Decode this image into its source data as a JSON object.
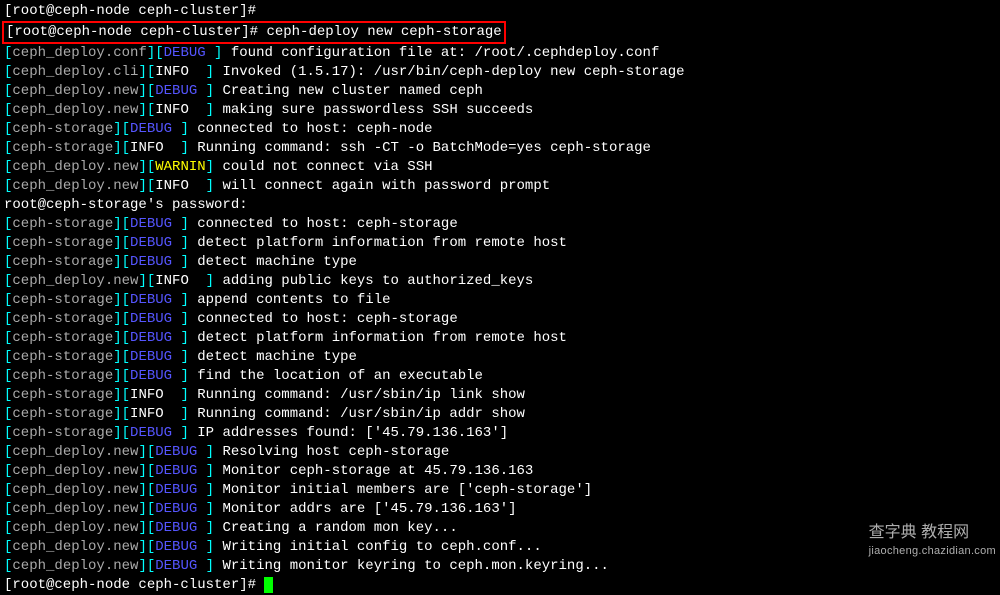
{
  "prompt": {
    "user": "root",
    "host": "ceph-node",
    "path": "ceph-cluster",
    "command": "ceph-deploy new ceph-storage"
  },
  "lines": [
    {
      "bracket_parts": [
        {
          "text": "[",
          "class": "cyan"
        },
        {
          "text": "ceph_deploy.conf",
          "class": "grey"
        },
        {
          "text": "]",
          "class": "cyan"
        },
        {
          "text": "[",
          "class": "cyan"
        },
        {
          "text": "DEBUG",
          "class": "blue"
        },
        {
          "text": " ]",
          "class": "cyan"
        }
      ],
      "msg": " found configuration file at: /root/.cephdeploy.conf"
    },
    {
      "bracket_parts": [
        {
          "text": "[",
          "class": "cyan"
        },
        {
          "text": "ceph_deploy.cli",
          "class": "grey"
        },
        {
          "text": "]",
          "class": "cyan"
        },
        {
          "text": "[",
          "class": "cyan"
        },
        {
          "text": "INFO  ",
          "class": "white"
        },
        {
          "text": "]",
          "class": "cyan"
        }
      ],
      "msg": " Invoked (1.5.17): /usr/bin/ceph-deploy new ceph-storage"
    },
    {
      "bracket_parts": [
        {
          "text": "[",
          "class": "cyan"
        },
        {
          "text": "ceph_deploy.new",
          "class": "grey"
        },
        {
          "text": "]",
          "class": "cyan"
        },
        {
          "text": "[",
          "class": "cyan"
        },
        {
          "text": "DEBUG",
          "class": "blue"
        },
        {
          "text": " ]",
          "class": "cyan"
        }
      ],
      "msg": " Creating new cluster named ceph"
    },
    {
      "bracket_parts": [
        {
          "text": "[",
          "class": "cyan"
        },
        {
          "text": "ceph_deploy.new",
          "class": "grey"
        },
        {
          "text": "]",
          "class": "cyan"
        },
        {
          "text": "[",
          "class": "cyan"
        },
        {
          "text": "INFO  ",
          "class": "white"
        },
        {
          "text": "]",
          "class": "cyan"
        }
      ],
      "msg": " making sure passwordless SSH succeeds"
    },
    {
      "bracket_parts": [
        {
          "text": "[",
          "class": "cyan"
        },
        {
          "text": "ceph-storage",
          "class": "grey"
        },
        {
          "text": "]",
          "class": "cyan"
        },
        {
          "text": "[",
          "class": "cyan"
        },
        {
          "text": "DEBUG",
          "class": "blue"
        },
        {
          "text": " ]",
          "class": "cyan"
        }
      ],
      "msg": " connected to host: ceph-node "
    },
    {
      "bracket_parts": [
        {
          "text": "[",
          "class": "cyan"
        },
        {
          "text": "ceph-storage",
          "class": "grey"
        },
        {
          "text": "]",
          "class": "cyan"
        },
        {
          "text": "[",
          "class": "cyan"
        },
        {
          "text": "INFO  ",
          "class": "white"
        },
        {
          "text": "]",
          "class": "cyan"
        }
      ],
      "msg": " Running command: ssh -CT -o BatchMode=yes ceph-storage"
    },
    {
      "bracket_parts": [
        {
          "text": "[",
          "class": "cyan"
        },
        {
          "text": "ceph_deploy.new",
          "class": "grey"
        },
        {
          "text": "]",
          "class": "cyan"
        },
        {
          "text": "[",
          "class": "cyan"
        },
        {
          "text": "WARNIN",
          "class": "yellow"
        },
        {
          "text": "]",
          "class": "cyan"
        }
      ],
      "msg": " could not connect via SSH"
    },
    {
      "bracket_parts": [
        {
          "text": "[",
          "class": "cyan"
        },
        {
          "text": "ceph_deploy.new",
          "class": "grey"
        },
        {
          "text": "]",
          "class": "cyan"
        },
        {
          "text": "[",
          "class": "cyan"
        },
        {
          "text": "INFO  ",
          "class": "white"
        },
        {
          "text": "]",
          "class": "cyan"
        }
      ],
      "msg": " will connect again with password prompt"
    },
    {
      "plain": "root@ceph-storage's password: "
    },
    {
      "bracket_parts": [
        {
          "text": "[",
          "class": "cyan"
        },
        {
          "text": "ceph-storage",
          "class": "grey"
        },
        {
          "text": "]",
          "class": "cyan"
        },
        {
          "text": "[",
          "class": "cyan"
        },
        {
          "text": "DEBUG",
          "class": "blue"
        },
        {
          "text": " ]",
          "class": "cyan"
        }
      ],
      "msg": " connected to host: ceph-storage "
    },
    {
      "bracket_parts": [
        {
          "text": "[",
          "class": "cyan"
        },
        {
          "text": "ceph-storage",
          "class": "grey"
        },
        {
          "text": "]",
          "class": "cyan"
        },
        {
          "text": "[",
          "class": "cyan"
        },
        {
          "text": "DEBUG",
          "class": "blue"
        },
        {
          "text": " ]",
          "class": "cyan"
        }
      ],
      "msg": " detect platform information from remote host"
    },
    {
      "bracket_parts": [
        {
          "text": "[",
          "class": "cyan"
        },
        {
          "text": "ceph-storage",
          "class": "grey"
        },
        {
          "text": "]",
          "class": "cyan"
        },
        {
          "text": "[",
          "class": "cyan"
        },
        {
          "text": "DEBUG",
          "class": "blue"
        },
        {
          "text": " ]",
          "class": "cyan"
        }
      ],
      "msg": " detect machine type"
    },
    {
      "bracket_parts": [
        {
          "text": "[",
          "class": "cyan"
        },
        {
          "text": "ceph_deploy.new",
          "class": "grey"
        },
        {
          "text": "]",
          "class": "cyan"
        },
        {
          "text": "[",
          "class": "cyan"
        },
        {
          "text": "INFO  ",
          "class": "white"
        },
        {
          "text": "]",
          "class": "cyan"
        }
      ],
      "msg": " adding public keys to authorized_keys"
    },
    {
      "bracket_parts": [
        {
          "text": "[",
          "class": "cyan"
        },
        {
          "text": "ceph-storage",
          "class": "grey"
        },
        {
          "text": "]",
          "class": "cyan"
        },
        {
          "text": "[",
          "class": "cyan"
        },
        {
          "text": "DEBUG",
          "class": "blue"
        },
        {
          "text": " ]",
          "class": "cyan"
        }
      ],
      "msg": " append contents to file"
    },
    {
      "bracket_parts": [
        {
          "text": "[",
          "class": "cyan"
        },
        {
          "text": "ceph-storage",
          "class": "grey"
        },
        {
          "text": "]",
          "class": "cyan"
        },
        {
          "text": "[",
          "class": "cyan"
        },
        {
          "text": "DEBUG",
          "class": "blue"
        },
        {
          "text": " ]",
          "class": "cyan"
        }
      ],
      "msg": " connected to host: ceph-storage "
    },
    {
      "bracket_parts": [
        {
          "text": "[",
          "class": "cyan"
        },
        {
          "text": "ceph-storage",
          "class": "grey"
        },
        {
          "text": "]",
          "class": "cyan"
        },
        {
          "text": "[",
          "class": "cyan"
        },
        {
          "text": "DEBUG",
          "class": "blue"
        },
        {
          "text": " ]",
          "class": "cyan"
        }
      ],
      "msg": " detect platform information from remote host"
    },
    {
      "bracket_parts": [
        {
          "text": "[",
          "class": "cyan"
        },
        {
          "text": "ceph-storage",
          "class": "grey"
        },
        {
          "text": "]",
          "class": "cyan"
        },
        {
          "text": "[",
          "class": "cyan"
        },
        {
          "text": "DEBUG",
          "class": "blue"
        },
        {
          "text": " ]",
          "class": "cyan"
        }
      ],
      "msg": " detect machine type"
    },
    {
      "bracket_parts": [
        {
          "text": "[",
          "class": "cyan"
        },
        {
          "text": "ceph-storage",
          "class": "grey"
        },
        {
          "text": "]",
          "class": "cyan"
        },
        {
          "text": "[",
          "class": "cyan"
        },
        {
          "text": "DEBUG",
          "class": "blue"
        },
        {
          "text": " ]",
          "class": "cyan"
        }
      ],
      "msg": " find the location of an executable"
    },
    {
      "bracket_parts": [
        {
          "text": "[",
          "class": "cyan"
        },
        {
          "text": "ceph-storage",
          "class": "grey"
        },
        {
          "text": "]",
          "class": "cyan"
        },
        {
          "text": "[",
          "class": "cyan"
        },
        {
          "text": "INFO  ",
          "class": "white"
        },
        {
          "text": "]",
          "class": "cyan"
        }
      ],
      "msg": " Running command: /usr/sbin/ip link show"
    },
    {
      "bracket_parts": [
        {
          "text": "[",
          "class": "cyan"
        },
        {
          "text": "ceph-storage",
          "class": "grey"
        },
        {
          "text": "]",
          "class": "cyan"
        },
        {
          "text": "[",
          "class": "cyan"
        },
        {
          "text": "INFO  ",
          "class": "white"
        },
        {
          "text": "]",
          "class": "cyan"
        }
      ],
      "msg": " Running command: /usr/sbin/ip addr show"
    },
    {
      "bracket_parts": [
        {
          "text": "[",
          "class": "cyan"
        },
        {
          "text": "ceph-storage",
          "class": "grey"
        },
        {
          "text": "]",
          "class": "cyan"
        },
        {
          "text": "[",
          "class": "cyan"
        },
        {
          "text": "DEBUG",
          "class": "blue"
        },
        {
          "text": " ]",
          "class": "cyan"
        }
      ],
      "msg": " IP addresses found: ['45.79.136.163']"
    },
    {
      "bracket_parts": [
        {
          "text": "[",
          "class": "cyan"
        },
        {
          "text": "ceph_deploy.new",
          "class": "grey"
        },
        {
          "text": "]",
          "class": "cyan"
        },
        {
          "text": "[",
          "class": "cyan"
        },
        {
          "text": "DEBUG",
          "class": "blue"
        },
        {
          "text": " ]",
          "class": "cyan"
        }
      ],
      "msg": " Resolving host ceph-storage"
    },
    {
      "bracket_parts": [
        {
          "text": "[",
          "class": "cyan"
        },
        {
          "text": "ceph_deploy.new",
          "class": "grey"
        },
        {
          "text": "]",
          "class": "cyan"
        },
        {
          "text": "[",
          "class": "cyan"
        },
        {
          "text": "DEBUG",
          "class": "blue"
        },
        {
          "text": " ]",
          "class": "cyan"
        }
      ],
      "msg": " Monitor ceph-storage at 45.79.136.163"
    },
    {
      "bracket_parts": [
        {
          "text": "[",
          "class": "cyan"
        },
        {
          "text": "ceph_deploy.new",
          "class": "grey"
        },
        {
          "text": "]",
          "class": "cyan"
        },
        {
          "text": "[",
          "class": "cyan"
        },
        {
          "text": "DEBUG",
          "class": "blue"
        },
        {
          "text": " ]",
          "class": "cyan"
        }
      ],
      "msg": " Monitor initial members are ['ceph-storage']"
    },
    {
      "bracket_parts": [
        {
          "text": "[",
          "class": "cyan"
        },
        {
          "text": "ceph_deploy.new",
          "class": "grey"
        },
        {
          "text": "]",
          "class": "cyan"
        },
        {
          "text": "[",
          "class": "cyan"
        },
        {
          "text": "DEBUG",
          "class": "blue"
        },
        {
          "text": " ]",
          "class": "cyan"
        }
      ],
      "msg": " Monitor addrs are ['45.79.136.163']"
    },
    {
      "bracket_parts": [
        {
          "text": "[",
          "class": "cyan"
        },
        {
          "text": "ceph_deploy.new",
          "class": "grey"
        },
        {
          "text": "]",
          "class": "cyan"
        },
        {
          "text": "[",
          "class": "cyan"
        },
        {
          "text": "DEBUG",
          "class": "blue"
        },
        {
          "text": " ]",
          "class": "cyan"
        }
      ],
      "msg": " Creating a random mon key..."
    },
    {
      "bracket_parts": [
        {
          "text": "[",
          "class": "cyan"
        },
        {
          "text": "ceph_deploy.new",
          "class": "grey"
        },
        {
          "text": "]",
          "class": "cyan"
        },
        {
          "text": "[",
          "class": "cyan"
        },
        {
          "text": "DEBUG",
          "class": "blue"
        },
        {
          "text": " ]",
          "class": "cyan"
        }
      ],
      "msg": " Writing initial config to ceph.conf..."
    },
    {
      "bracket_parts": [
        {
          "text": "[",
          "class": "cyan"
        },
        {
          "text": "ceph_deploy.new",
          "class": "grey"
        },
        {
          "text": "]",
          "class": "cyan"
        },
        {
          "text": "[",
          "class": "cyan"
        },
        {
          "text": "DEBUG",
          "class": "blue"
        },
        {
          "text": " ]",
          "class": "cyan"
        }
      ],
      "msg": " Writing monitor keyring to ceph.mon.keyring..."
    }
  ],
  "watermark": {
    "top": "查字典 教程网",
    "url": "jiaocheng.chazidian.com"
  }
}
